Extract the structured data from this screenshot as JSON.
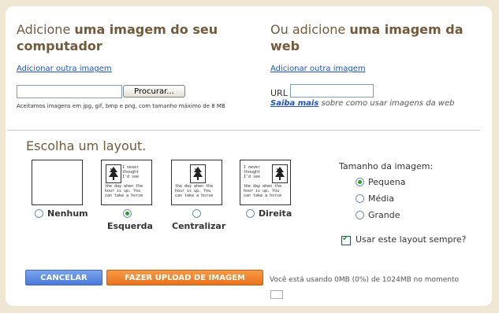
{
  "upload_local": {
    "title_normal": "Adicione ",
    "title_bold_1": "uma imagem do seu",
    "title_bold_2": "computador",
    "add_another_link": "Adicionar outra imagem",
    "browse_button": "Procurar...",
    "file_value": "",
    "accepted_formats_note": "Aceitamos imagens em jpg, gif, bmp e png, com tamanho máximo de 8 MB"
  },
  "upload_web": {
    "title_normal": "Ou adicione ",
    "title_bold_1": "uma imagem da",
    "title_bold_2": "web",
    "add_another_link": "Adicionar outra imagem",
    "url_label": "URL",
    "url_value": "",
    "learn_more_link": "Saiba mais",
    "learn_more_text": " sobre como usar imagens da web"
  },
  "layout": {
    "heading": "Escolha um layout.",
    "thumb_text": "I never\nthought\nI'd see\nthe day when the\nhour is up. You\ncan take a horse",
    "thumb_text_center": "I never      I never\nthought      thought\nI'd see      I'd see\nthe day when the\nhour is up. You\ncan take a horse",
    "options": [
      {
        "label": "Nenhum",
        "selected": false
      },
      {
        "label": "Esquerda",
        "selected": true
      },
      {
        "label": "Centralizar",
        "selected": false
      },
      {
        "label": "Direita",
        "selected": false
      }
    ]
  },
  "image_size": {
    "heading": "Tamanho da imagem:",
    "options": [
      {
        "label": "Pequena",
        "selected": true
      },
      {
        "label": "Média",
        "selected": false
      },
      {
        "label": "Grande",
        "selected": false
      }
    ],
    "always_use_label": "Usar este layout sempre?",
    "always_use_checked": true
  },
  "actions": {
    "cancel": "CANCELAR",
    "upload": "FAZER UPLOAD DE IMAGEM"
  },
  "usage_text": "Você está usando 0MB (0%) de 1024MB no momento",
  "colors": {
    "heading": "#735a3b",
    "link": "#2151bd",
    "cancel_button": "#4a79d9",
    "upload_button": "#e9721d",
    "frame": "#efe6d3"
  }
}
